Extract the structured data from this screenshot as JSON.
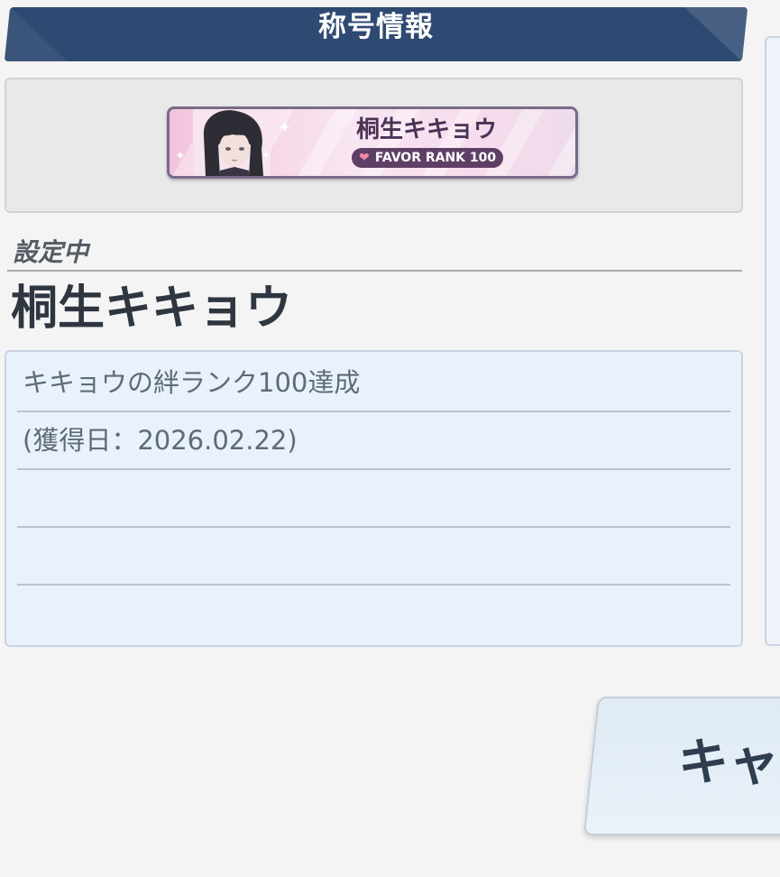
{
  "header": {
    "title": "称号情報"
  },
  "title_plate": {
    "name": "桐生キキョウ",
    "badge": "FAVOR RANK 100",
    "badge_icon": "heart-icon"
  },
  "current": {
    "label": "設定中",
    "title": "桐生キキョウ"
  },
  "description": {
    "lines": [
      "キキョウの絆ランク100達成",
      "(獲得日：2026.02.22)",
      "",
      ""
    ]
  },
  "buttons": {
    "cancel_partial": "キャ"
  },
  "colors": {
    "header_bg": "#2f4a72",
    "desc_bg": "#e9f2fc",
    "badge_bg": "#5e3f66",
    "plate_pink": "#f3c4dc"
  }
}
